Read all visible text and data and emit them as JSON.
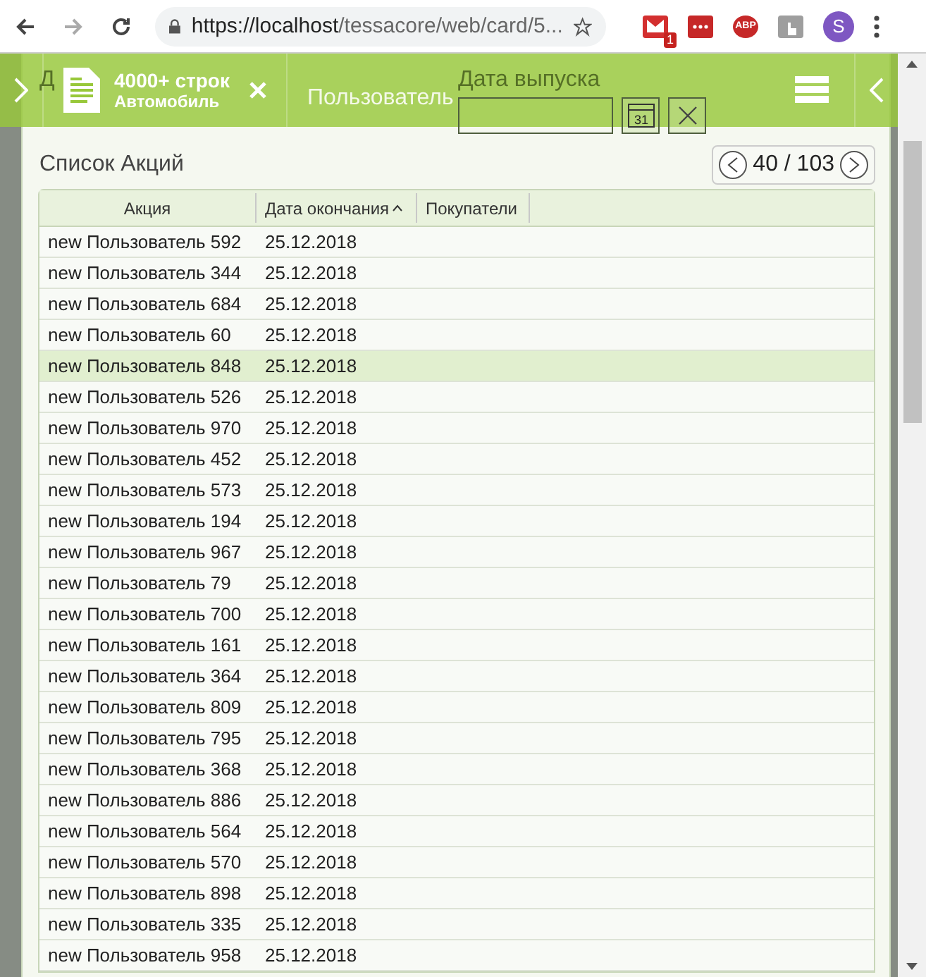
{
  "browser": {
    "url_host": "https://localhost",
    "url_path": "/tessacore/web/card/5...",
    "mail_badge": "1",
    "adblock_label": "ABP",
    "profile_initial": "S"
  },
  "overlay_bar": {
    "title": "4000+ строк",
    "subtitle": "Автомобиль",
    "center_label": "Пользователь"
  },
  "form": {
    "fields": [
      {
        "label": "Д",
        "kind": "plain"
      },
      {
        "label": "Дата выпуска",
        "kind": "date",
        "calendar_day": "31"
      }
    ]
  },
  "list": {
    "title": "Список Акций",
    "pager": "40 / 103",
    "columns": [
      {
        "label": "Акция",
        "sorted": false
      },
      {
        "label": "Дата окончания",
        "sorted": true
      },
      {
        "label": "Покупатели",
        "sorted": false
      }
    ],
    "rows": [
      {
        "action": "new Пользователь 592",
        "date": "25.12.2018",
        "selected": false
      },
      {
        "action": "new Пользователь 344",
        "date": "25.12.2018",
        "selected": false
      },
      {
        "action": "new Пользователь 684",
        "date": "25.12.2018",
        "selected": false
      },
      {
        "action": "new Пользователь 60",
        "date": "25.12.2018",
        "selected": false
      },
      {
        "action": "new Пользователь 848",
        "date": "25.12.2018",
        "selected": true
      },
      {
        "action": "new Пользователь 526",
        "date": "25.12.2018",
        "selected": false
      },
      {
        "action": "new Пользователь 970",
        "date": "25.12.2018",
        "selected": false
      },
      {
        "action": "new Пользователь 452",
        "date": "25.12.2018",
        "selected": false
      },
      {
        "action": "new Пользователь 573",
        "date": "25.12.2018",
        "selected": false
      },
      {
        "action": "new Пользователь 194",
        "date": "25.12.2018",
        "selected": false
      },
      {
        "action": "new Пользователь 967",
        "date": "25.12.2018",
        "selected": false
      },
      {
        "action": "new Пользователь 79",
        "date": "25.12.2018",
        "selected": false
      },
      {
        "action": "new Пользователь 700",
        "date": "25.12.2018",
        "selected": false
      },
      {
        "action": "new Пользователь 161",
        "date": "25.12.2018",
        "selected": false
      },
      {
        "action": "new Пользователь 364",
        "date": "25.12.2018",
        "selected": false
      },
      {
        "action": "new Пользователь 809",
        "date": "25.12.2018",
        "selected": false
      },
      {
        "action": "new Пользователь 795",
        "date": "25.12.2018",
        "selected": false
      },
      {
        "action": "new Пользователь 368",
        "date": "25.12.2018",
        "selected": false
      },
      {
        "action": "new Пользователь 886",
        "date": "25.12.2018",
        "selected": false
      },
      {
        "action": "new Пользователь 564",
        "date": "25.12.2018",
        "selected": false
      },
      {
        "action": "new Пользователь 570",
        "date": "25.12.2018",
        "selected": false
      },
      {
        "action": "new Пользователь 898",
        "date": "25.12.2018",
        "selected": false
      },
      {
        "action": "new Пользователь 335",
        "date": "25.12.2018",
        "selected": false
      },
      {
        "action": "new Пользователь 958",
        "date": "25.12.2018",
        "selected": false
      }
    ]
  }
}
